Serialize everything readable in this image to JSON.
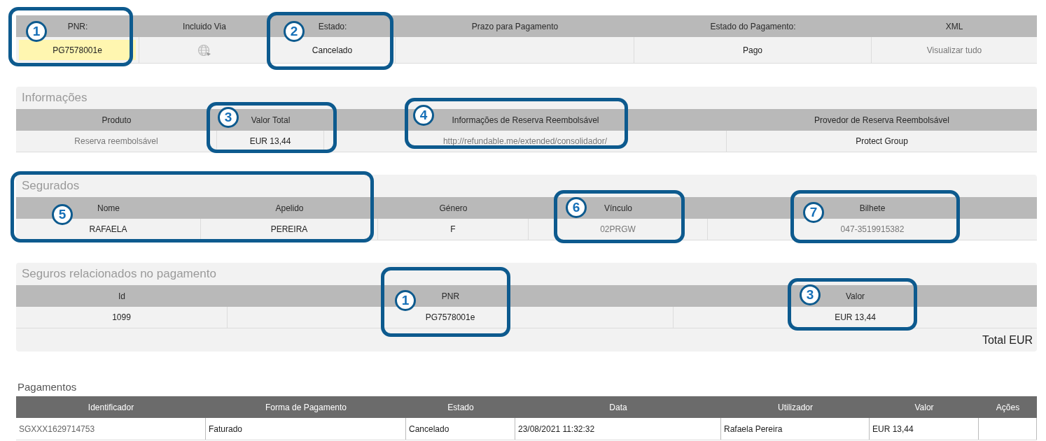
{
  "booking_table": {
    "columns": [
      "PNR:",
      "Incluido Via",
      "Estado:",
      "Prazo para Pagamento",
      "Estado do Pagamento:",
      "XML"
    ],
    "row": [
      {
        "kind": "highlight",
        "text": "PG7578001e"
      },
      {
        "kind": "icon"
      },
      {
        "kind": "text",
        "text": "Cancelado"
      },
      {
        "kind": "empty"
      },
      {
        "kind": "text",
        "text": "Pago"
      },
      {
        "kind": "link",
        "text": "Visualizar tudo"
      }
    ]
  },
  "sections": [
    {
      "title": "Informações",
      "columns": [
        "Produto",
        "Valor Total",
        "Informações de Reserva Reembolsável",
        "Provedor de Reserva Reembolsável"
      ],
      "row": [
        {
          "kind": "muted",
          "text": "Reserva reembolsável"
        },
        {
          "kind": "text",
          "text": "EUR 13,44"
        },
        {
          "kind": "link",
          "text": "http://refundable.me/extended/consolidador/"
        },
        {
          "kind": "text",
          "text": "Protect Group"
        }
      ]
    },
    {
      "title": "Segurados",
      "columns": [
        "Nome",
        "Apelido",
        "Género",
        "Vínculo",
        "Bilhete"
      ],
      "row": [
        {
          "kind": "text",
          "text": "RAFAELA"
        },
        {
          "kind": "text",
          "text": "PEREIRA"
        },
        {
          "kind": "text",
          "text": "F"
        },
        {
          "kind": "muted",
          "text": "02PRGW"
        },
        {
          "kind": "muted",
          "text": "047-3519915382"
        }
      ]
    },
    {
      "title": "Seguros relacionados no pagamento",
      "columns": [
        "Id",
        "PNR",
        "Valor"
      ],
      "row": [
        {
          "kind": "text",
          "text": "1099"
        },
        {
          "kind": "text",
          "text": "PG7578001e"
        },
        {
          "kind": "text",
          "text": "EUR 13,44"
        }
      ],
      "total": "Total EUR"
    }
  ],
  "payments": {
    "title": "Pagamentos",
    "columns": [
      "Identificador",
      "Forma de Pagamento",
      "Estado",
      "Data",
      "Utilizador",
      "Valor",
      "Ações"
    ],
    "row": [
      "SGXXX1629714753",
      "Faturado",
      "Cancelado",
      "23/08/2021 11:32:32",
      "Rafaela Pereira",
      "EUR 13,44"
    ]
  },
  "callouts": [
    {
      "number": "1"
    },
    {
      "number": "2"
    },
    {
      "number": "3"
    },
    {
      "number": "4"
    },
    {
      "number": "5"
    },
    {
      "number": "6"
    },
    {
      "number": "7"
    },
    {
      "number": "1"
    },
    {
      "number": "3"
    }
  ]
}
